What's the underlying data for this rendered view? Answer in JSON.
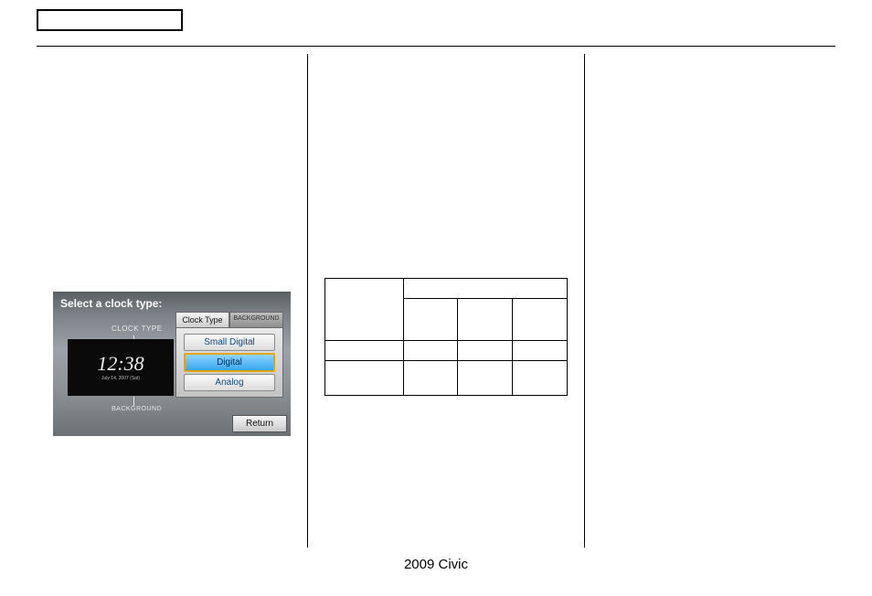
{
  "footer": {
    "text": "2009  Civic"
  },
  "screenshot": {
    "title": "Select a clock type:",
    "label_clocktype": "CLOCK TYPE",
    "label_background": "BACKGROUND",
    "clock_time": "12:38",
    "clock_date": "July 14, 2007 (Sat)",
    "tab_clocktype": "Clock Type",
    "tab_background": "BACKGROUND",
    "opt_small": "Small Digital",
    "opt_digital": "Digital",
    "opt_analog": "Analog",
    "return": "Return"
  }
}
